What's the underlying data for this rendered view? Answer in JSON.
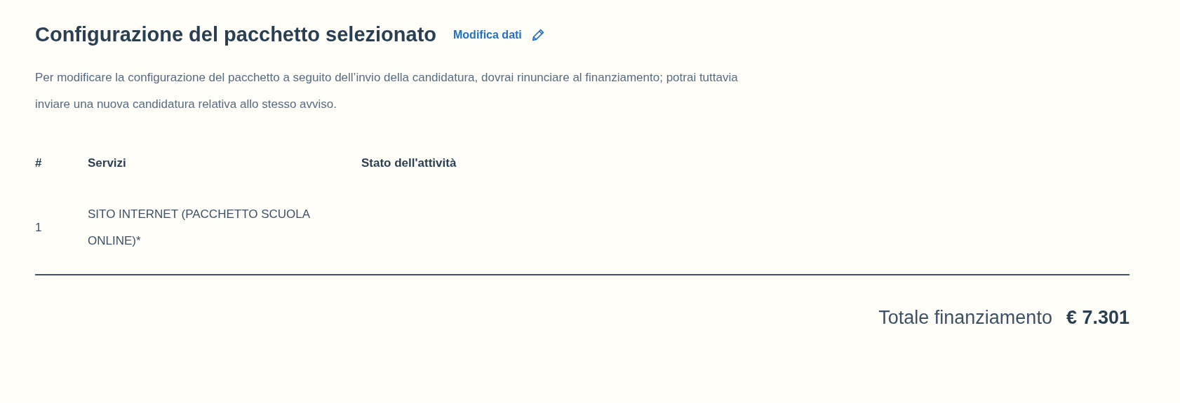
{
  "heading": {
    "title": "Configurazione del pacchetto selezionato",
    "edit_link": "Modifica dati"
  },
  "description": "Per modificare la configurazione del pacchetto a seguito dell’invio della candidatura, dovrai rinunciare al finanziamento; potrai tuttavia inviare una nuova candidatura relativa allo stesso avviso.",
  "table": {
    "columns": [
      "#",
      "Servizi",
      "Stato dell'attività"
    ],
    "rows": [
      [
        "1",
        "SITO INTERNET (PACCHETTO SCUOLA ONLINE)*",
        ""
      ]
    ]
  },
  "total": {
    "label": "Totale finanziamento",
    "value": "€ 7.301"
  }
}
